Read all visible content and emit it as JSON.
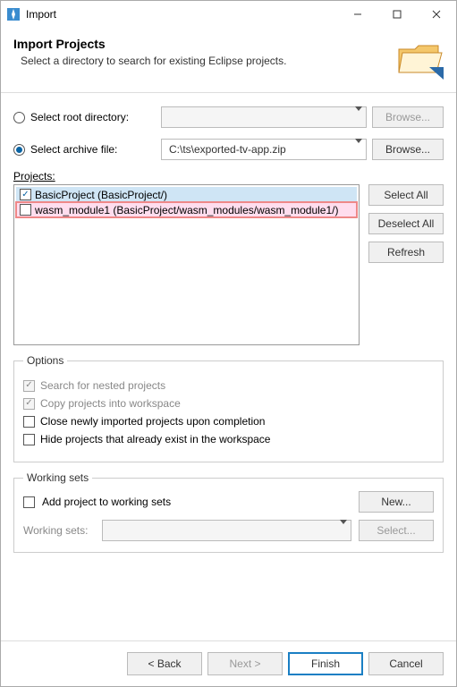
{
  "window": {
    "title": "Import"
  },
  "banner": {
    "heading": "Import Projects",
    "description": "Select a directory to search for existing Eclipse projects."
  },
  "source": {
    "root_label": "Select root directory:",
    "root_value": "",
    "root_browse": "Browse...",
    "archive_label": "Select archive file:",
    "archive_value": "C:\\ts\\exported-tv-app.zip",
    "archive_browse": "Browse..."
  },
  "projects": {
    "label": "Projects:",
    "items": [
      {
        "checked": true,
        "label": "BasicProject (BasicProject/)",
        "selected": true
      },
      {
        "checked": false,
        "label": "wasm_module1 (BasicProject/wasm_modules/wasm_module1/)",
        "highlighted": true
      }
    ],
    "select_all": "Select All",
    "deselect_all": "Deselect All",
    "refresh": "Refresh"
  },
  "options": {
    "legend": "Options",
    "search_nested": "Search for nested projects",
    "copy_workspace": "Copy projects into workspace",
    "close_newly": "Close newly imported projects upon completion",
    "hide_existing": "Hide projects that already exist in the workspace"
  },
  "working_sets": {
    "legend": "Working sets",
    "add_label": "Add project to working sets",
    "new_btn": "New...",
    "list_label": "Working sets:",
    "select_btn": "Select..."
  },
  "footer": {
    "back": "< Back",
    "next": "Next >",
    "finish": "Finish",
    "cancel": "Cancel"
  }
}
